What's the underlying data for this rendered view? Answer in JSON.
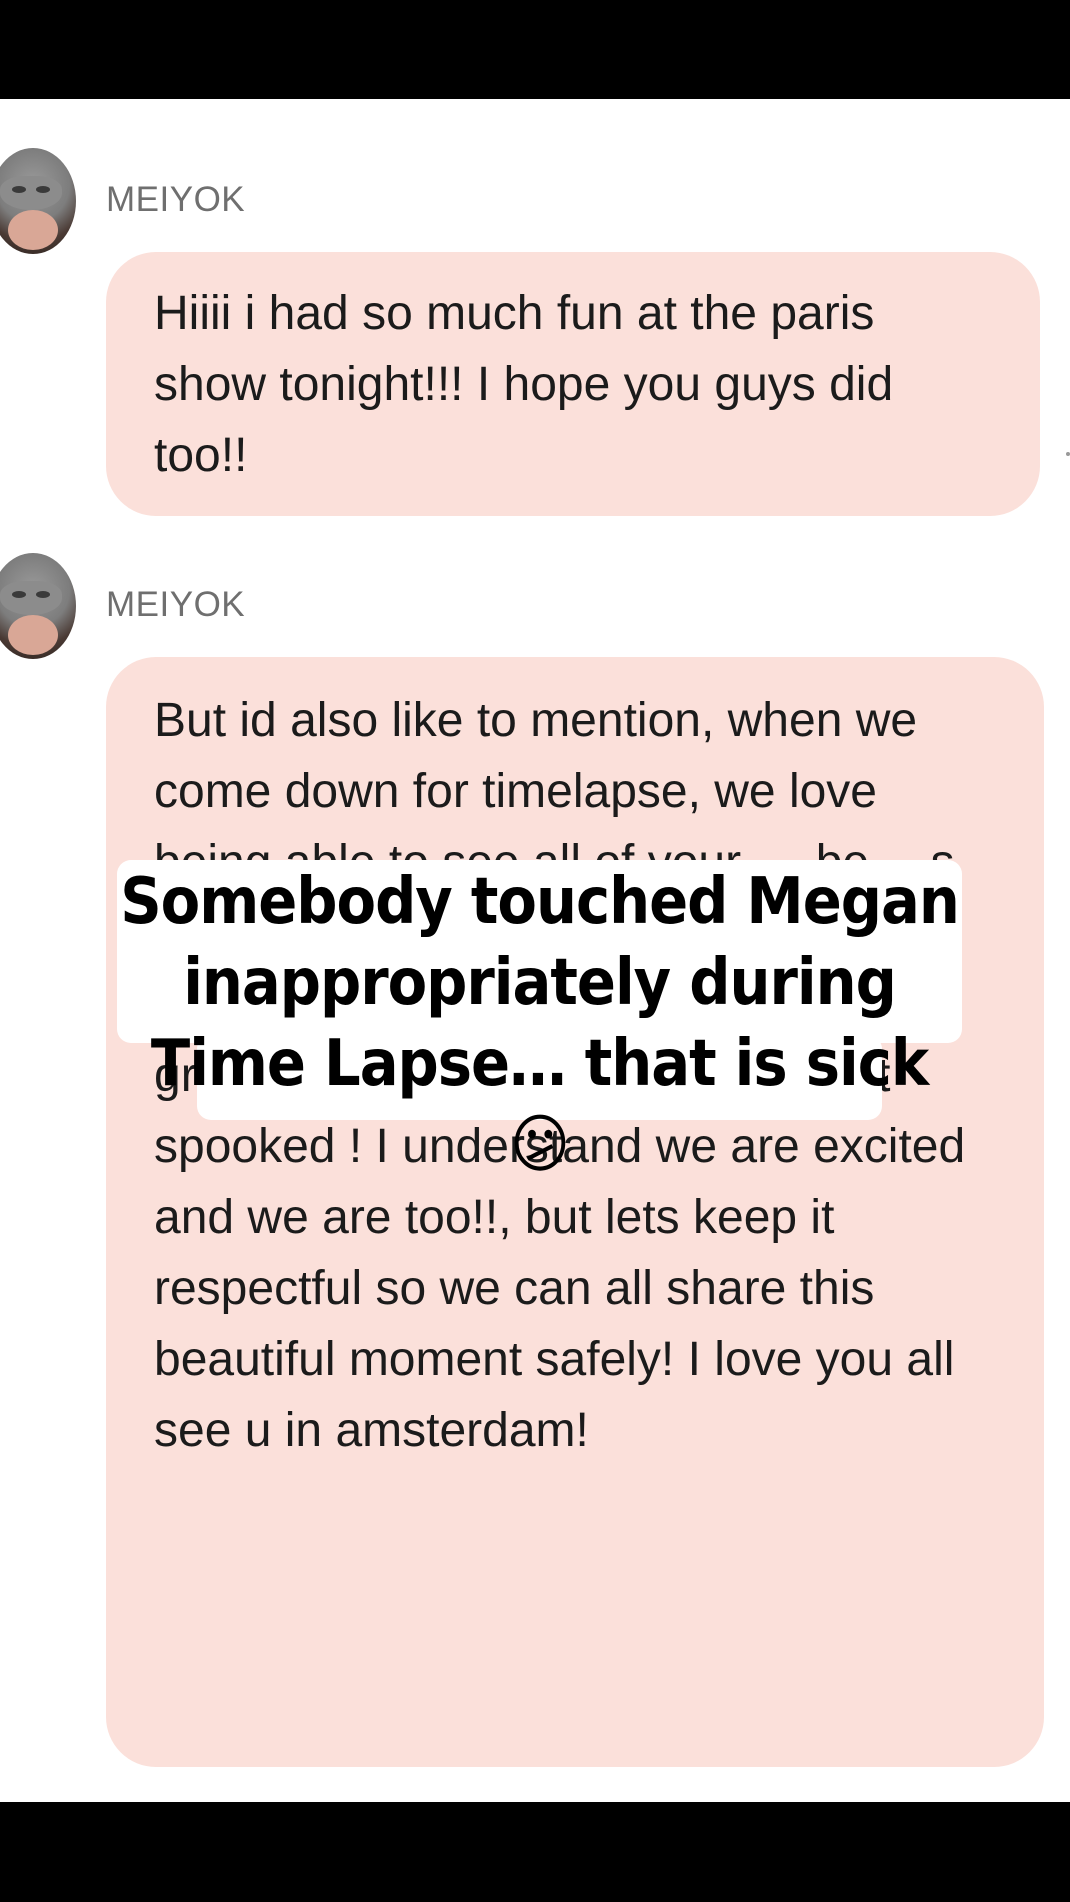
{
  "messages": [
    {
      "sender": "MEIYOK",
      "text": "Hiiii i had so much fun at the paris show tonight!!! I hope you guys did too!!"
    },
    {
      "sender": "MEIYOK",
      "text": "But id also like to mention, when we come down for timelapse, we love being able to see all of your … be… s in inappropriate areas / or inappropriately 🥹💗 today someone grabbed my chest and left me a bit spooked !  I understand we are excited and we are too!!, but lets keep it respectful so we can all share this beautiful moment safely! I love you all see u in amsterdam!"
    }
  ],
  "caption": "Somebody touched Megan inappropriately during Time Lapse… that is sick 😕",
  "icons": {
    "avatar": "masked-person-avatar"
  }
}
